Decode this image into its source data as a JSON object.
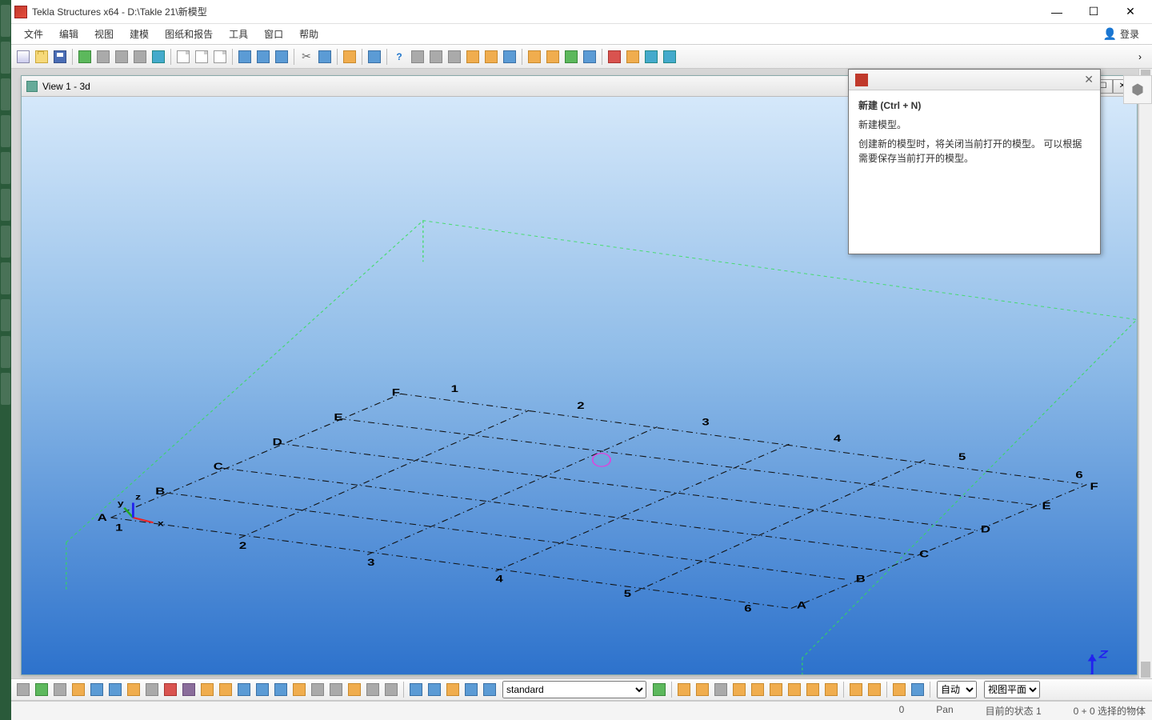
{
  "title": "Tekla Structures x64 - D:\\Takle 21\\新模型",
  "login_label": "登录",
  "menu": [
    "文件",
    "编辑",
    "视图",
    "建模",
    "图纸和报告",
    "工具",
    "窗口",
    "帮助"
  ],
  "view": {
    "title": "View 1 - 3d"
  },
  "tooltip": {
    "title": "新建  (Ctrl + N)",
    "line1": "新建模型。",
    "line2": "创建新的模型时，将关闭当前打开的模型。 可以根据需要保存当前打开的模型。"
  },
  "grid": {
    "num_labels": [
      "1",
      "2",
      "3",
      "4",
      "5",
      "6"
    ],
    "letter_labels": [
      "A",
      "B",
      "C",
      "D",
      "E",
      "F"
    ],
    "axes": [
      "x",
      "y",
      "z"
    ]
  },
  "toolbar_top_groups": [
    [
      "new",
      "open",
      "save"
    ],
    [
      "share",
      "link1",
      "link2",
      "cloud",
      "wire"
    ],
    [
      "page1",
      "page2",
      "page3"
    ],
    [
      "win1",
      "win2",
      "win3"
    ],
    [
      "cut",
      "lasso"
    ],
    [
      "clipboard"
    ],
    [
      "pointer"
    ],
    [
      "help",
      "grid1",
      "grid2",
      "dim1",
      "dim2",
      "dim3",
      "dim4"
    ],
    [
      "copy",
      "paste",
      "macro",
      "macro2"
    ],
    [
      "red1",
      "usr",
      "find",
      "mgr"
    ]
  ],
  "toolbar_bottom": {
    "dropdown_value": "standard",
    "dropdowns_right": [
      "自动",
      "视图平面"
    ]
  },
  "status": {
    "zero": "0",
    "pan": "Pan",
    "state": "目前的状态 1",
    "selection": "0 + 0 选择的物体"
  }
}
